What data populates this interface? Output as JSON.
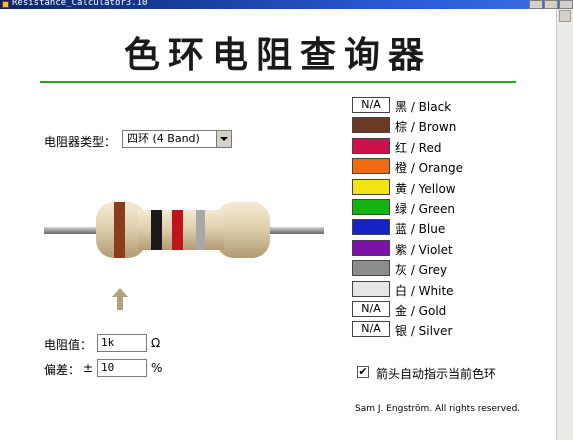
{
  "window": {
    "title": "Resistance_Calculator3.10"
  },
  "heading": "色环电阻查询器",
  "band_type": {
    "label": "电阻器类型：",
    "selected": "四环 (4 Band)"
  },
  "resistance": {
    "label": "电阻值：",
    "value": "1k",
    "unit": "Ω"
  },
  "tolerance": {
    "label": "偏差：",
    "sign": "±",
    "value": "10",
    "unit": "%"
  },
  "colors": [
    {
      "name": "黑 / Black",
      "swatch": "N/A",
      "hex": ""
    },
    {
      "name": "棕 / Brown",
      "swatch": "",
      "hex": "#6b3a24"
    },
    {
      "name": "红 / Red",
      "swatch": "",
      "hex": "#d0104a"
    },
    {
      "name": "橙 / Orange",
      "swatch": "",
      "hex": "#f06a14"
    },
    {
      "name": "黄 / Yellow",
      "swatch": "",
      "hex": "#f2e414"
    },
    {
      "name": "绿 / Green",
      "swatch": "",
      "hex": "#12b412"
    },
    {
      "name": "蓝 / Blue",
      "swatch": "",
      "hex": "#1424c4"
    },
    {
      "name": "紫 / Violet",
      "swatch": "",
      "hex": "#7a12a8"
    },
    {
      "name": "灰 / Grey",
      "swatch": "",
      "hex": "#8c8c8c"
    },
    {
      "name": "白 / White",
      "swatch": "",
      "hex": "#e6e6e6"
    },
    {
      "name": "金 / Gold",
      "swatch": "N/A",
      "hex": ""
    },
    {
      "name": "银 / Silver",
      "swatch": "N/A",
      "hex": ""
    }
  ],
  "resistor_bands": [
    {
      "color": "brown",
      "hex": "#8a3c1c"
    },
    {
      "color": "black",
      "hex": "#1a1a1a"
    },
    {
      "color": "red",
      "hex": "#c0141c"
    },
    {
      "color": "silver",
      "hex": "#a8a8a8"
    }
  ],
  "auto_indicator": {
    "label": "箭头自动指示当前色环",
    "checked": true,
    "mark": "✔"
  },
  "copyright": "Sam J. Engström. All rights reserved."
}
